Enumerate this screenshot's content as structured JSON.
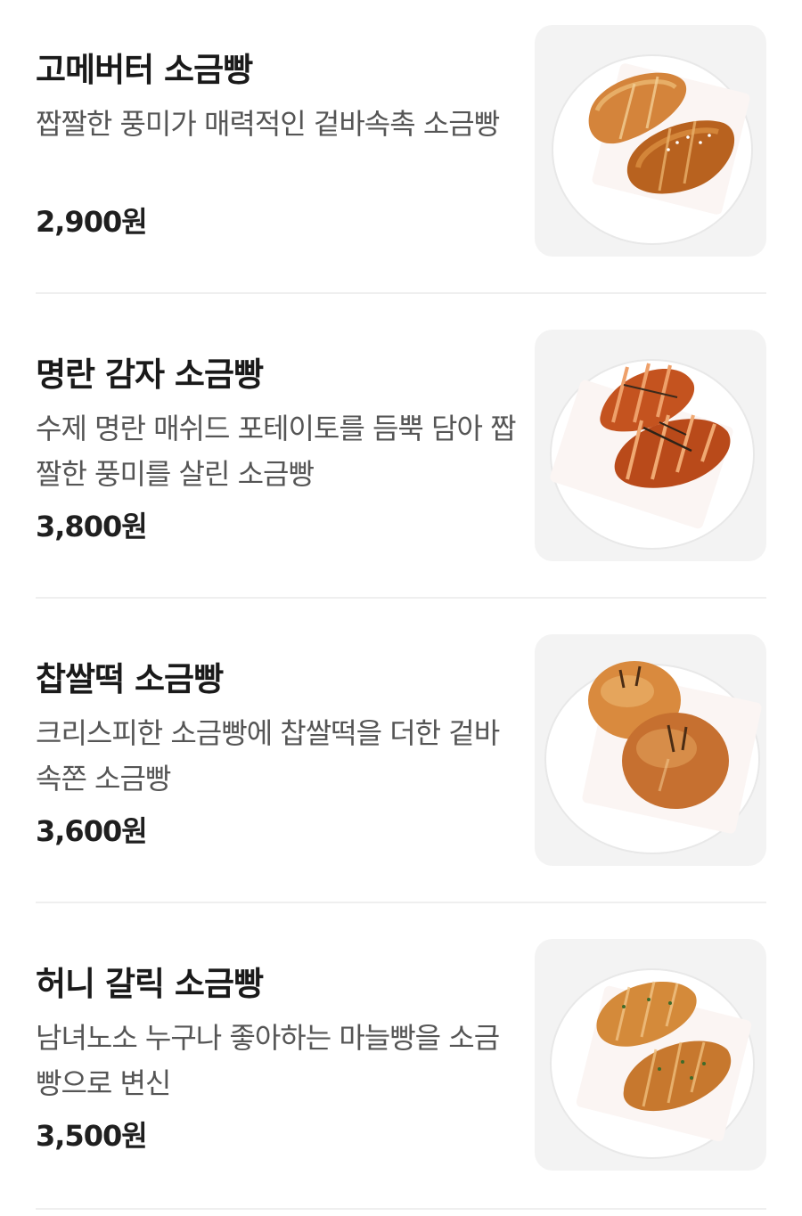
{
  "menu": {
    "items": [
      {
        "name": "고메버터 소금빵",
        "description": "짭짤한 풍미가 매력적인 겉바속촉 소금빵",
        "price": "2,900원",
        "photo_icon": "butter-salt-bread-photo"
      },
      {
        "name": "명란 감자 소금빵",
        "description": "수제 명란 매쉬드 포테이토를 듬뿍 담아 짭짤한 풍미를 살린 소금빵",
        "price": "3,800원",
        "photo_icon": "mentaiko-potato-salt-bread-photo"
      },
      {
        "name": "찹쌀떡 소금빵",
        "description": "크리스피한 소금빵에 찹쌀떡을 더한 겉바속쫀 소금빵",
        "price": "3,600원",
        "photo_icon": "rice-cake-salt-bread-photo"
      },
      {
        "name": "허니 갈릭 소금빵",
        "description": "남녀노소 누구나 좋아하는 마늘빵을 소금빵으로 변신",
        "price": "3,500원",
        "photo_icon": "honey-garlic-salt-bread-photo"
      }
    ]
  },
  "colors": {
    "text_primary": "#1a1a1a",
    "text_secondary": "#555555",
    "divider": "#efefef",
    "thumb_bg": "#f3f3f3",
    "bread_light": "#e3a456",
    "bread_dark": "#b0561c"
  }
}
